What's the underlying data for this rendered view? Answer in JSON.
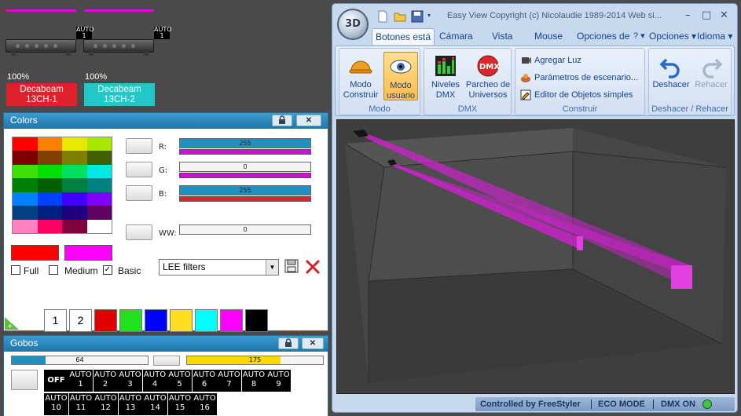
{
  "fixtures": [
    {
      "percent": "100%",
      "name": "Decabeam",
      "channel": "13CH-1",
      "color": "#e0202a",
      "auto_line1": "AUTO",
      "auto_line2": "1"
    },
    {
      "percent": "100%",
      "name": "Decabeam",
      "channel": "13CH-2",
      "color": "#20c8c8",
      "auto_line1": "AUTO",
      "auto_line2": "1"
    }
  ],
  "colors_panel": {
    "title": "Colors",
    "swatches": [
      "#ff0000",
      "#ff8000",
      "#e8e800",
      "#a8e800",
      "#800000",
      "#804000",
      "#808000",
      "#406000",
      "#40e000",
      "#00e000",
      "#00e060",
      "#00e8e8",
      "#008000",
      "#006000",
      "#008040",
      "#008080",
      "#0080ff",
      "#0040ff",
      "#4000ff",
      "#8000ff",
      "#004080",
      "#002080",
      "#200080",
      "#600060",
      "#ff80c0",
      "#ff0060",
      "#800040",
      "#ffffff"
    ],
    "channels": [
      {
        "label": "R:",
        "value": "255",
        "line_color": "#e000e0",
        "fill": "#2090c0"
      },
      {
        "label": "G:",
        "value": "0",
        "line_color": "#e000e0",
        "fill": "#f4f4f4"
      },
      {
        "label": "B:",
        "value": "255",
        "line_color": "#e0202a",
        "fill": "#2090c0"
      },
      {
        "label": "WW:",
        "value": "0",
        "line_color": "",
        "fill": "#f4f4f4"
      }
    ],
    "current_color": "#ff0000",
    "target_color": "#ff00ff",
    "options": {
      "full": "Full",
      "medium": "Medium",
      "basic": "Basic",
      "basic_checked": "✓"
    },
    "filter_select": "LEE filters",
    "memory": [
      {
        "label": "1",
        "color": "#ffffff"
      },
      {
        "label": "2",
        "color": "#ffffff"
      },
      {
        "label": "",
        "color": "#e00000"
      },
      {
        "label": "",
        "color": "#20e020"
      },
      {
        "label": "",
        "color": "#0000ff"
      },
      {
        "label": "",
        "color": "#ffe020"
      },
      {
        "label": "",
        "color": "#00ffff"
      },
      {
        "label": "",
        "color": "#ff00ff"
      },
      {
        "label": "",
        "color": "#000000"
      }
    ]
  },
  "gobos_panel": {
    "title": "Gobos",
    "slider1_value": "64",
    "slider1_fraction": 0.25,
    "slider2_value": "175",
    "slider2_fraction": 0.69,
    "off_label": "OFF",
    "cells": [
      {
        "l1": "AUTO",
        "l2": "1"
      },
      {
        "l1": "AUTO",
        "l2": "2"
      },
      {
        "l1": "AUTO",
        "l2": "3"
      },
      {
        "l1": "AUTO",
        "l2": "4"
      },
      {
        "l1": "AUTO",
        "l2": "5"
      },
      {
        "l1": "AUTO",
        "l2": "6"
      },
      {
        "l1": "AUTO",
        "l2": "7"
      },
      {
        "l1": "AUTO",
        "l2": "8"
      },
      {
        "l1": "AUTO",
        "l2": "9"
      },
      {
        "l1": "AUTO",
        "l2": "10"
      },
      {
        "l1": "AUTO",
        "l2": "11"
      },
      {
        "l1": "AUTO",
        "l2": "12"
      },
      {
        "l1": "AUTO",
        "l2": "13"
      },
      {
        "l1": "AUTO",
        "l2": "14"
      },
      {
        "l1": "AUTO",
        "l2": "15"
      },
      {
        "l1": "AUTO",
        "l2": "16"
      }
    ]
  },
  "easyview": {
    "logo": "3D",
    "title": "Easy View   Copyright (c) Nicolaudie 1989-2014   Web si...",
    "window_controls": {
      "minimize": "–",
      "maximize": "□",
      "close": "✕"
    },
    "tabs": [
      "Botones está",
      "Cámara",
      "Vista",
      "Mouse",
      "Opciones de",
      "? ▾",
      "Opciones ▾",
      "Idioma ▾"
    ],
    "groups": {
      "modo": {
        "label": "Modo",
        "buttons": [
          {
            "line1": "Modo",
            "line2": "Construir"
          },
          {
            "line1": "Modo",
            "line2": "usuario"
          }
        ]
      },
      "dmx": {
        "label": "DMX",
        "buttons": [
          {
            "line1": "Niveles",
            "line2": "DMX"
          },
          {
            "line1": "Parcheo de",
            "line2": "Universos"
          }
        ],
        "badge": "DMX"
      },
      "construir": {
        "label": "Construir",
        "items": [
          "Agregar Luz",
          "Parámetros de escenario...",
          "Editor de Objetos simples"
        ]
      },
      "deshacer": {
        "label": "Deshacer / Rehacer",
        "undo": "Deshacer",
        "redo": "Rehacer"
      }
    },
    "status": {
      "controlled": "Controlled by FreeStyler",
      "eco": "ECO MODE",
      "dmx": "DMX ON",
      "dmx_led": "#3ec93e"
    }
  }
}
